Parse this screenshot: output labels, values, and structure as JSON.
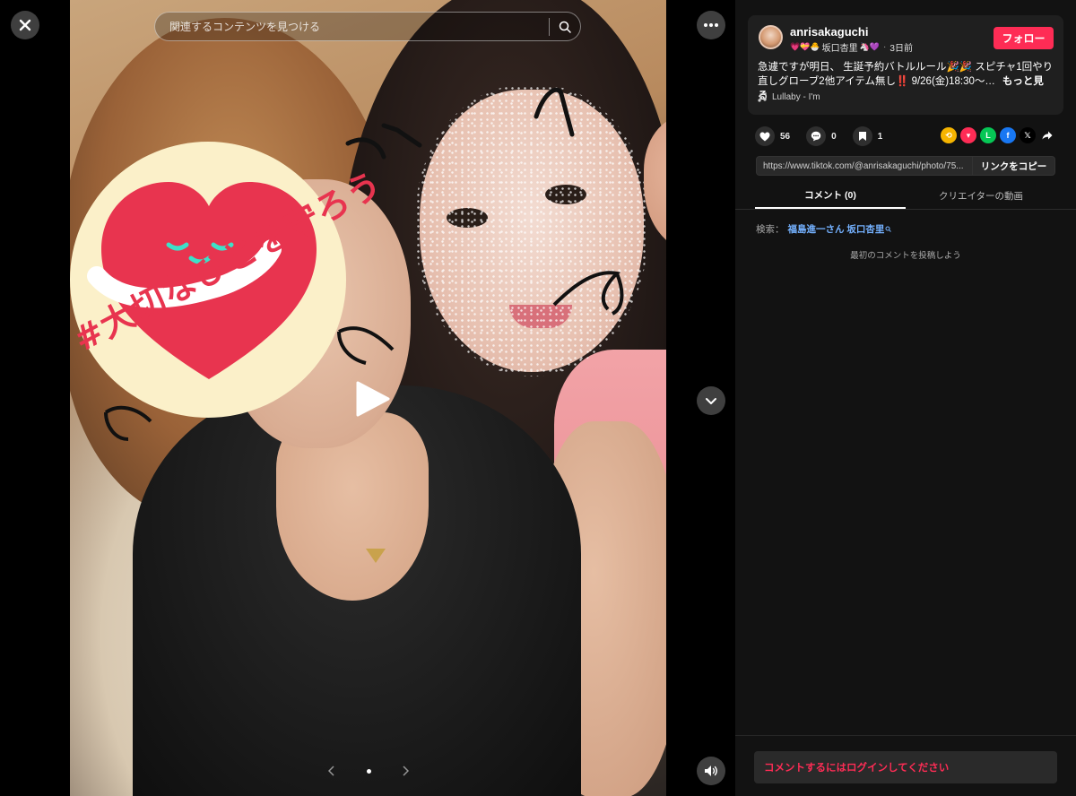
{
  "viewer": {
    "search": {
      "placeholder": "関連するコンテンツを見つける"
    },
    "sticker_text": "#大切なひとを守ろう"
  },
  "post": {
    "author": {
      "username": "anrisakaguchi",
      "display_name": "坂口杏里",
      "posted": "3日前"
    },
    "follow_label": "フォロー",
    "caption": "急遽ですが明日、 生誕予約バトルルール🎉🎉 スピチャ1回やり直しグローブ2他アイテム無し‼️ 9/26(金)18:30〜…",
    "more_label": "もっと見る",
    "music": "Lullaby - I'm",
    "stats": {
      "likes": "56",
      "comments": "0",
      "saves": "1"
    },
    "link": "https://www.tiktok.com/@anrisakaguchi/photo/75...",
    "copy_label": "リンクをコピー"
  },
  "tabs": {
    "comments": "コメント (0)",
    "creator_videos": "クリエイターの動画"
  },
  "search_hint": {
    "label": "検索：",
    "keyword": "福島進一さん 坂口杏里"
  },
  "empty_comments": "最初のコメントを投稿しよう",
  "login_prompt": "コメントするにはログインしてください",
  "colors": {
    "accent": "#fe2c55",
    "link": "#74b1ff",
    "panel_bg": "#121212",
    "card_bg": "#1f1f1f"
  }
}
